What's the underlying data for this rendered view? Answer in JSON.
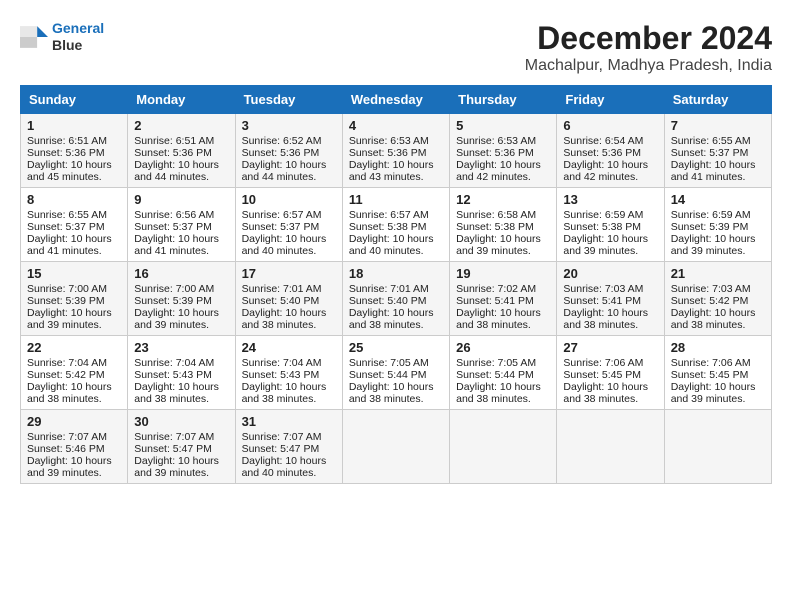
{
  "logo": {
    "line1": "General",
    "line2": "Blue"
  },
  "title": "December 2024",
  "subtitle": "Machalpur, Madhya Pradesh, India",
  "headers": [
    "Sunday",
    "Monday",
    "Tuesday",
    "Wednesday",
    "Thursday",
    "Friday",
    "Saturday"
  ],
  "weeks": [
    [
      {
        "day": "1",
        "sunrise": "Sunrise: 6:51 AM",
        "sunset": "Sunset: 5:36 PM",
        "daylight": "Daylight: 10 hours and 45 minutes."
      },
      {
        "day": "2",
        "sunrise": "Sunrise: 6:51 AM",
        "sunset": "Sunset: 5:36 PM",
        "daylight": "Daylight: 10 hours and 44 minutes."
      },
      {
        "day": "3",
        "sunrise": "Sunrise: 6:52 AM",
        "sunset": "Sunset: 5:36 PM",
        "daylight": "Daylight: 10 hours and 44 minutes."
      },
      {
        "day": "4",
        "sunrise": "Sunrise: 6:53 AM",
        "sunset": "Sunset: 5:36 PM",
        "daylight": "Daylight: 10 hours and 43 minutes."
      },
      {
        "day": "5",
        "sunrise": "Sunrise: 6:53 AM",
        "sunset": "Sunset: 5:36 PM",
        "daylight": "Daylight: 10 hours and 42 minutes."
      },
      {
        "day": "6",
        "sunrise": "Sunrise: 6:54 AM",
        "sunset": "Sunset: 5:36 PM",
        "daylight": "Daylight: 10 hours and 42 minutes."
      },
      {
        "day": "7",
        "sunrise": "Sunrise: 6:55 AM",
        "sunset": "Sunset: 5:37 PM",
        "daylight": "Daylight: 10 hours and 41 minutes."
      }
    ],
    [
      {
        "day": "8",
        "sunrise": "Sunrise: 6:55 AM",
        "sunset": "Sunset: 5:37 PM",
        "daylight": "Daylight: 10 hours and 41 minutes."
      },
      {
        "day": "9",
        "sunrise": "Sunrise: 6:56 AM",
        "sunset": "Sunset: 5:37 PM",
        "daylight": "Daylight: 10 hours and 41 minutes."
      },
      {
        "day": "10",
        "sunrise": "Sunrise: 6:57 AM",
        "sunset": "Sunset: 5:37 PM",
        "daylight": "Daylight: 10 hours and 40 minutes."
      },
      {
        "day": "11",
        "sunrise": "Sunrise: 6:57 AM",
        "sunset": "Sunset: 5:38 PM",
        "daylight": "Daylight: 10 hours and 40 minutes."
      },
      {
        "day": "12",
        "sunrise": "Sunrise: 6:58 AM",
        "sunset": "Sunset: 5:38 PM",
        "daylight": "Daylight: 10 hours and 39 minutes."
      },
      {
        "day": "13",
        "sunrise": "Sunrise: 6:59 AM",
        "sunset": "Sunset: 5:38 PM",
        "daylight": "Daylight: 10 hours and 39 minutes."
      },
      {
        "day": "14",
        "sunrise": "Sunrise: 6:59 AM",
        "sunset": "Sunset: 5:39 PM",
        "daylight": "Daylight: 10 hours and 39 minutes."
      }
    ],
    [
      {
        "day": "15",
        "sunrise": "Sunrise: 7:00 AM",
        "sunset": "Sunset: 5:39 PM",
        "daylight": "Daylight: 10 hours and 39 minutes."
      },
      {
        "day": "16",
        "sunrise": "Sunrise: 7:00 AM",
        "sunset": "Sunset: 5:39 PM",
        "daylight": "Daylight: 10 hours and 39 minutes."
      },
      {
        "day": "17",
        "sunrise": "Sunrise: 7:01 AM",
        "sunset": "Sunset: 5:40 PM",
        "daylight": "Daylight: 10 hours and 38 minutes."
      },
      {
        "day": "18",
        "sunrise": "Sunrise: 7:01 AM",
        "sunset": "Sunset: 5:40 PM",
        "daylight": "Daylight: 10 hours and 38 minutes."
      },
      {
        "day": "19",
        "sunrise": "Sunrise: 7:02 AM",
        "sunset": "Sunset: 5:41 PM",
        "daylight": "Daylight: 10 hours and 38 minutes."
      },
      {
        "day": "20",
        "sunrise": "Sunrise: 7:03 AM",
        "sunset": "Sunset: 5:41 PM",
        "daylight": "Daylight: 10 hours and 38 minutes."
      },
      {
        "day": "21",
        "sunrise": "Sunrise: 7:03 AM",
        "sunset": "Sunset: 5:42 PM",
        "daylight": "Daylight: 10 hours and 38 minutes."
      }
    ],
    [
      {
        "day": "22",
        "sunrise": "Sunrise: 7:04 AM",
        "sunset": "Sunset: 5:42 PM",
        "daylight": "Daylight: 10 hours and 38 minutes."
      },
      {
        "day": "23",
        "sunrise": "Sunrise: 7:04 AM",
        "sunset": "Sunset: 5:43 PM",
        "daylight": "Daylight: 10 hours and 38 minutes."
      },
      {
        "day": "24",
        "sunrise": "Sunrise: 7:04 AM",
        "sunset": "Sunset: 5:43 PM",
        "daylight": "Daylight: 10 hours and 38 minutes."
      },
      {
        "day": "25",
        "sunrise": "Sunrise: 7:05 AM",
        "sunset": "Sunset: 5:44 PM",
        "daylight": "Daylight: 10 hours and 38 minutes."
      },
      {
        "day": "26",
        "sunrise": "Sunrise: 7:05 AM",
        "sunset": "Sunset: 5:44 PM",
        "daylight": "Daylight: 10 hours and 38 minutes."
      },
      {
        "day": "27",
        "sunrise": "Sunrise: 7:06 AM",
        "sunset": "Sunset: 5:45 PM",
        "daylight": "Daylight: 10 hours and 38 minutes."
      },
      {
        "day": "28",
        "sunrise": "Sunrise: 7:06 AM",
        "sunset": "Sunset: 5:45 PM",
        "daylight": "Daylight: 10 hours and 39 minutes."
      }
    ],
    [
      {
        "day": "29",
        "sunrise": "Sunrise: 7:07 AM",
        "sunset": "Sunset: 5:46 PM",
        "daylight": "Daylight: 10 hours and 39 minutes."
      },
      {
        "day": "30",
        "sunrise": "Sunrise: 7:07 AM",
        "sunset": "Sunset: 5:47 PM",
        "daylight": "Daylight: 10 hours and 39 minutes."
      },
      {
        "day": "31",
        "sunrise": "Sunrise: 7:07 AM",
        "sunset": "Sunset: 5:47 PM",
        "daylight": "Daylight: 10 hours and 40 minutes."
      },
      null,
      null,
      null,
      null
    ]
  ]
}
